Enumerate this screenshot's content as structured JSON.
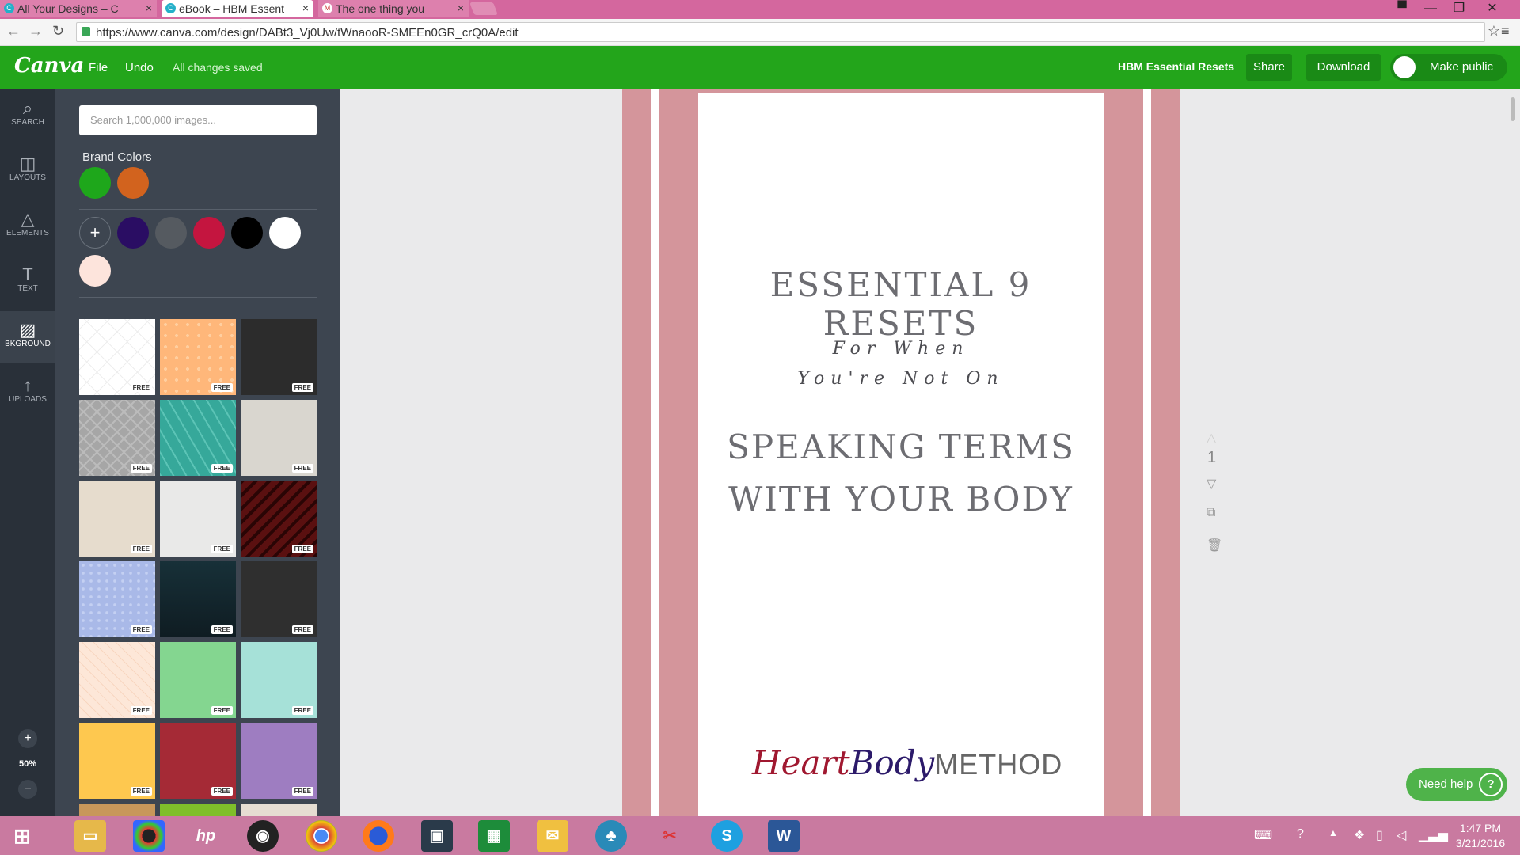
{
  "browser": {
    "tabs": [
      {
        "title": "All Your Designs – C",
        "icon": "canva-icon"
      },
      {
        "title": "eBook – HBM Essent",
        "icon": "canva-icon"
      },
      {
        "title": "The one thing you",
        "icon": "gmail-icon"
      }
    ],
    "url": "https://www.canva.com/design/DABt3_Vj0Uw/tWnaooR-SMEEn0GR_crQ0A/edit",
    "window_controls": [
      "minimize",
      "maximize",
      "close"
    ]
  },
  "header": {
    "logo": "Canva",
    "file_label": "File",
    "undo_label": "Undo",
    "save_status": "All changes saved",
    "doc_name": "HBM Essential Resets",
    "share_label": "Share",
    "download_label": "Download",
    "make_public_label": "Make public"
  },
  "rail": {
    "items": [
      {
        "label": "SEARCH",
        "icon": "search-icon"
      },
      {
        "label": "LAYOUTS",
        "icon": "layouts-icon"
      },
      {
        "label": "ELEMENTS",
        "icon": "elements-icon"
      },
      {
        "label": "TEXT",
        "icon": "text-icon"
      },
      {
        "label": "BKGROUND",
        "icon": "background-icon"
      },
      {
        "label": "UPLOADS",
        "icon": "uploads-icon"
      }
    ],
    "zoom": "50%"
  },
  "panel": {
    "search_placeholder": "Search 1,000,000 images...",
    "brand_colors_label": "Brand Colors",
    "brand_colors": [
      "#1ea71b",
      "#d2631e"
    ],
    "doc_colors": [
      "#2a0d63",
      "#555a60",
      "#c4153f",
      "#000000",
      "#ffffff",
      "#fde4dc"
    ],
    "free_label": "FREE",
    "backgrounds": [
      "#ffffff",
      "#ffb77a",
      "#2c2c2c",
      "#a6a6a6",
      "#36a89a",
      "#d9d6cf",
      "#e6dccd",
      "#e9e9e8",
      "#5a1010",
      "#a9b9e8",
      "#173038",
      "#2f2f2f",
      "#fde7d8",
      "#84d690",
      "#a6e1d8",
      "#fec84f",
      "#a52a36",
      "#9e7dc1"
    ]
  },
  "design": {
    "title_line": "ESSENTIAL 9 RESETS",
    "sub_line1": "For When",
    "sub_line2": "You're Not On",
    "main_line1": "SPEAKING TERMS",
    "main_line2": "WITH YOUR BODY",
    "logo_heart": "Heart",
    "logo_body": "Body",
    "logo_method": "METHOD",
    "page_number": "1"
  },
  "help": {
    "label": "Need help",
    "q": "?"
  },
  "taskbar": {
    "time": "1:47 PM",
    "date": "3/21/2016",
    "apps": [
      "start-icon",
      "file-explorer-icon",
      "color-wheel-icon",
      "hp-icon",
      "camera-icon",
      "chrome-icon",
      "firefox-icon",
      "video-icon",
      "calculator-icon",
      "outlook-icon",
      "tree-app-icon",
      "snipping-tool-icon",
      "skype-icon",
      "word-icon"
    ]
  }
}
